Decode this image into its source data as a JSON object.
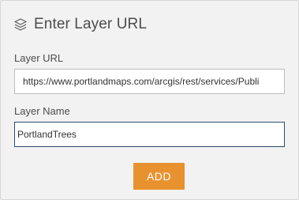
{
  "header": {
    "icon": "layers-icon",
    "title": "Enter Layer URL"
  },
  "form": {
    "url_label": "Layer URL",
    "url_value": "https://www.portlandmaps.com/arcgis/rest/services/Publi",
    "name_label": "Layer Name",
    "name_value": "PortlandTrees",
    "add_label": "ADD"
  },
  "colors": {
    "panel_background": "#f2f2f2",
    "title_text": "#4c4c4c",
    "focused_border": "#2e4b6b",
    "add_button": "#e8922f"
  }
}
